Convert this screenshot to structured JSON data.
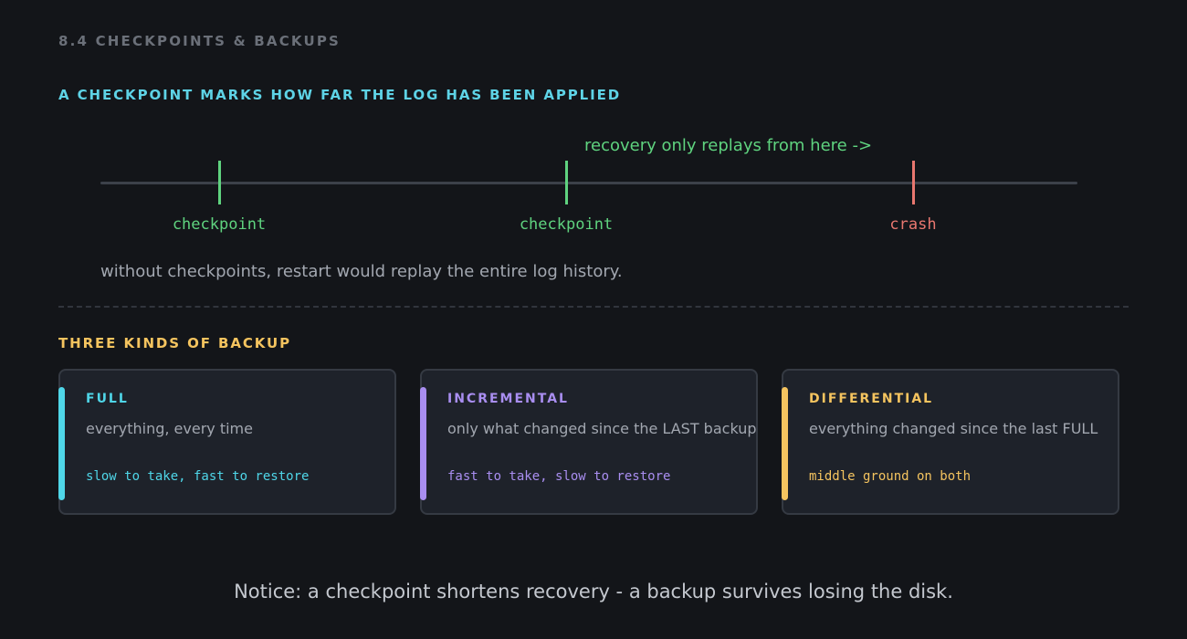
{
  "header": {
    "section": "8.4  CHECKPOINTS & BACKUPS",
    "subtitle": "A CHECKPOINT MARKS HOW FAR THE LOG HAS BEEN APPLIED"
  },
  "timeline": {
    "recovery_label": "recovery only replays from here ->",
    "markers": [
      {
        "label": "checkpoint",
        "color": "#5fd37f"
      },
      {
        "label": "checkpoint",
        "color": "#5fd37f"
      },
      {
        "label": "crash",
        "color": "#e8776f"
      }
    ],
    "note": "without checkpoints, restart would replay the entire log history."
  },
  "backups": {
    "heading": "THREE KINDS OF BACKUP",
    "cards": [
      {
        "title": "FULL",
        "description": "everything, every time",
        "tradeoff": "slow to take, fast to restore",
        "color": "#4fd6e8"
      },
      {
        "title": "INCREMENTAL",
        "description": "only what changed since the LAST backup",
        "tradeoff": "fast to take, slow to restore",
        "color": "#a98ef0"
      },
      {
        "title": "DIFFERENTIAL",
        "description": "everything changed since the last FULL",
        "tradeoff": "middle ground on both",
        "color": "#f5c45f"
      }
    ]
  },
  "footer": "Notice: a checkpoint shortens recovery - a backup survives losing the disk."
}
